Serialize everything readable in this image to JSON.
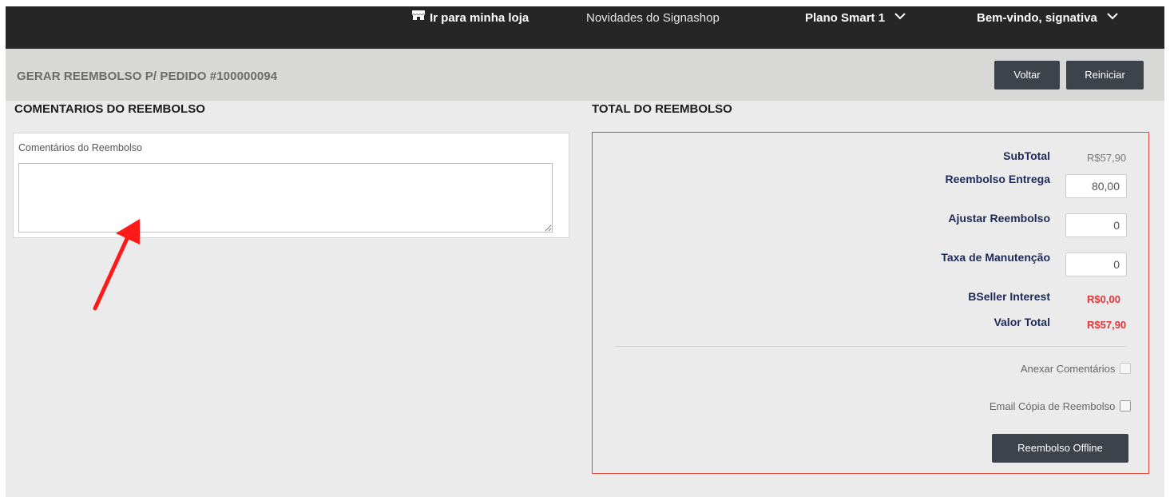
{
  "topbar": {
    "store_link": "Ir para minha loja",
    "store_icon": "store-icon",
    "news_link": "Novidades do Signashop",
    "plan_menu": "Plano Smart 1",
    "welcome_menu": "Bem-vindo, signativa",
    "dropdown_icon": "chevron-down-icon"
  },
  "header": {
    "title": "GERAR REEMBOLSO P/ PEDIDO #100000094",
    "back_label": "Voltar",
    "reset_label": "Reiniciar"
  },
  "comments": {
    "section_title": "COMENTARIOS DO REEMBOLSO",
    "field_label": "Comentários do Reembolso",
    "field_value": ""
  },
  "totals": {
    "section_title": "TOTAL DO REEMBOLSO",
    "subtotal_label": "SubTotal",
    "subtotal_value": "R$57,90",
    "shipping_label": "Reembolso Entrega",
    "shipping_value": "80,00",
    "adjust_label": "Ajustar Reembolso",
    "adjust_value": "0",
    "fee_label": "Taxa de Manutenção",
    "fee_value": "0",
    "interest_label": "BSeller Interest",
    "interest_value": "R$0,00",
    "total_label": "Valor Total",
    "total_value": "R$57,90",
    "attach_comments_label": "Anexar Comentários",
    "email_copy_label": "Email Cópia de Reembolso",
    "offline_button": "Reembolso Offline"
  },
  "colors": {
    "topbar_bg": "#262626",
    "header_bg": "#d8d8d6",
    "panel_border": "#e0443e",
    "label_navy": "#1e2a58",
    "accent_red": "#e0353a",
    "button_dark": "#3d434a",
    "annotation_arrow": "#ff1a1a"
  }
}
